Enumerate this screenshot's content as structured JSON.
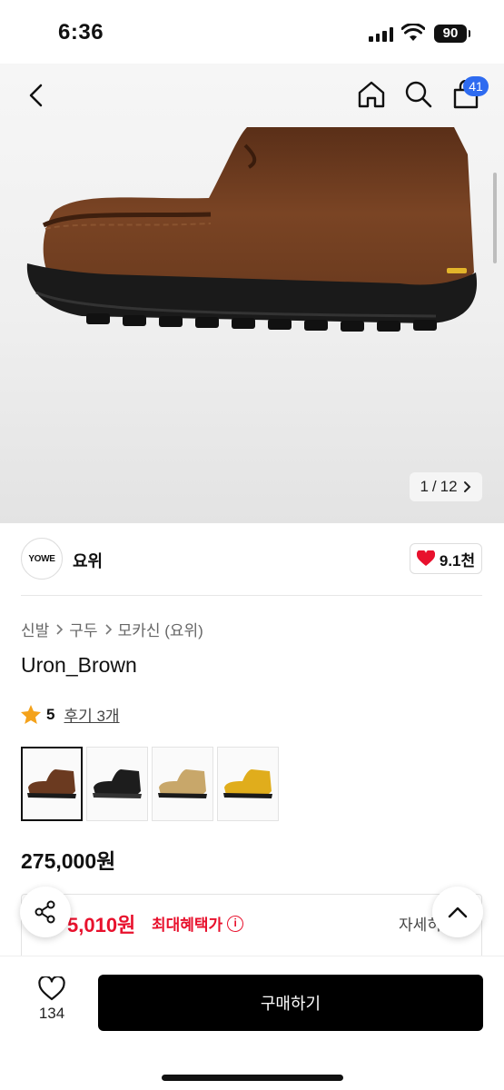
{
  "status_bar": {
    "time": "6:36",
    "battery": "90"
  },
  "nav": {
    "cart_count": "41"
  },
  "gallery": {
    "current": "1",
    "total": "12",
    "separator": "/"
  },
  "brand": {
    "logo_text": "YOWE",
    "name": "요위",
    "likes": "9.1천"
  },
  "breadcrumb": [
    "신발",
    "구두",
    "모카신 (요위)"
  ],
  "product": {
    "title": "Uron_Brown",
    "rating": "5",
    "review_text": "후기 3개",
    "price": "275,000원"
  },
  "thumbnails": [
    {
      "name": "brown",
      "color": "#6b3a20"
    },
    {
      "name": "black",
      "color": "#1d1d1d"
    },
    {
      "name": "beige",
      "color": "#c8a76a"
    },
    {
      "name": "yellow",
      "color": "#e0ad1c"
    }
  ],
  "benefit": {
    "price_partial": "5,010원",
    "label": "최대혜택가",
    "detail_partial": "자세히"
  },
  "bottom": {
    "wish_count": "134",
    "buy_label": "구매하기"
  },
  "colors": {
    "accent_blue": "#2e6bf0",
    "sale_red": "#e8112d",
    "heart_red": "#e8112d",
    "star": "#f4a21b"
  },
  "icons": [
    "back-icon",
    "home-icon",
    "search-icon",
    "bag-icon",
    "heart-icon",
    "star-icon",
    "share-icon",
    "chevron-up-icon",
    "info-icon"
  ]
}
